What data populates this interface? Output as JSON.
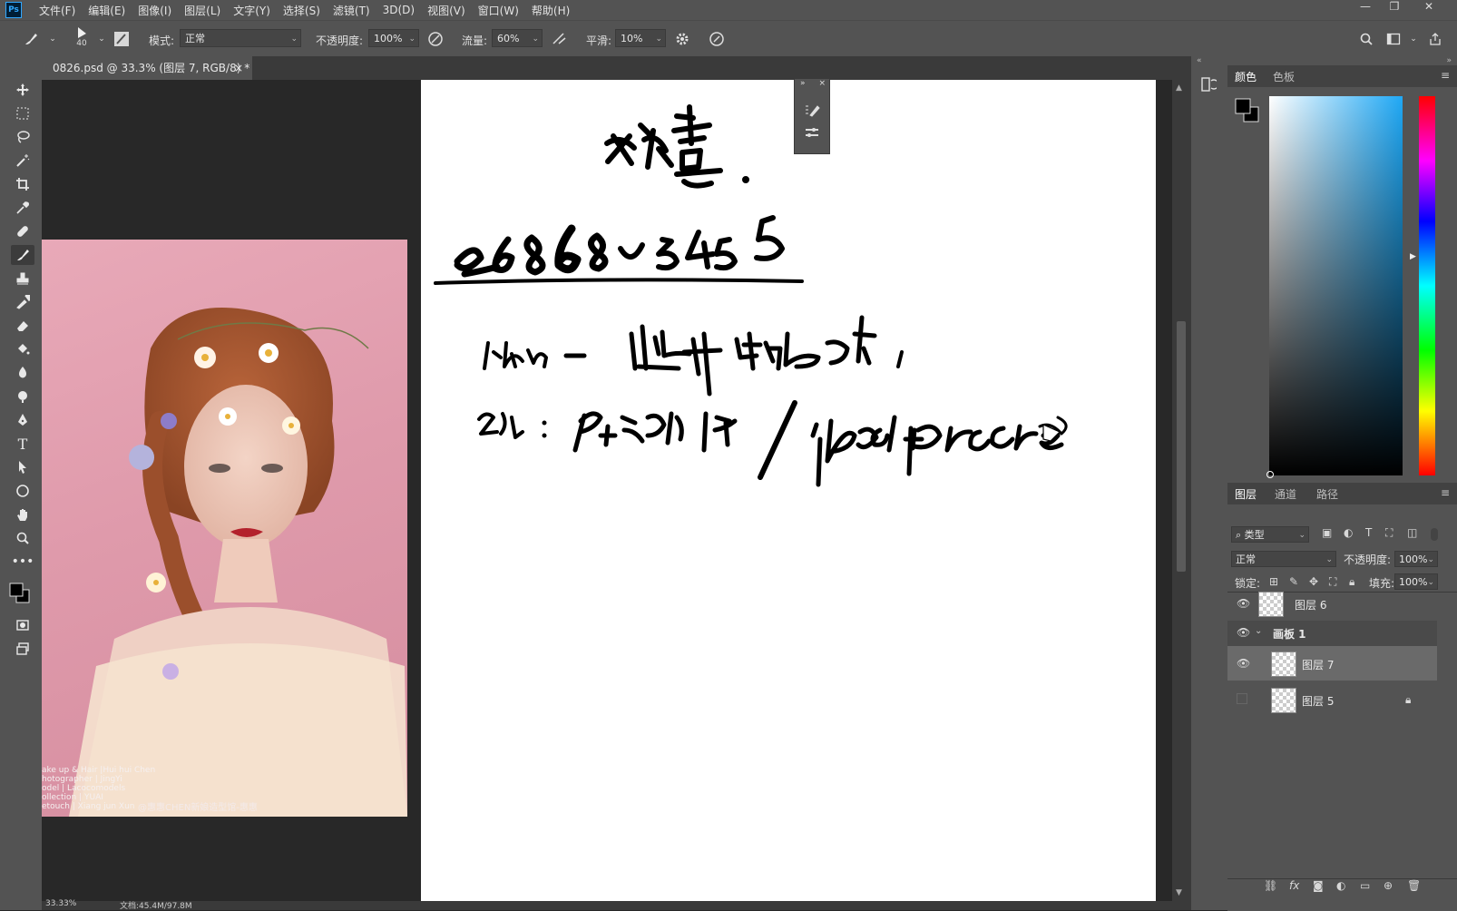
{
  "app": {
    "logo": "Ps"
  },
  "menu": [
    "文件(F)",
    "编辑(E)",
    "图像(I)",
    "图层(L)",
    "文字(Y)",
    "选择(S)",
    "滤镜(T)",
    "3D(D)",
    "视图(V)",
    "窗口(W)",
    "帮助(H)"
  ],
  "window_controls": {
    "minimize": "—",
    "restore": "❐",
    "close": "✕"
  },
  "options": {
    "brush_size": "40",
    "mode_label": "模式:",
    "mode_value": "正常",
    "opacity_label": "不透明度:",
    "opacity_value": "100%",
    "flow_label": "流量:",
    "flow_value": "60%",
    "smoothing_label": "平滑:",
    "smoothing_value": "10%"
  },
  "document": {
    "tab_title": "0826.psd @ 33.3% (图层 7, RGB/8) *",
    "close": "×"
  },
  "photo": {
    "credits": [
      "ake up & Hair |Hui hui Chen",
      "hotographer | JingYi",
      "odel | Lacocomodels",
      "ollection | YUAI",
      "etouch | Xiang jun Xun"
    ],
    "watermark": "@惠惠CHEN新娘造型馆-惠惠"
  },
  "status": {
    "zoom": "33.33%",
    "doc_info": "文档:45.4M/97.8M"
  },
  "color_panel": {
    "tab_color": "颜色",
    "tab_swatches": "色板"
  },
  "layers_panel": {
    "tab_layers": "图层",
    "tab_channels": "通道",
    "tab_paths": "路径",
    "filter_label": "类型",
    "blend_mode": "正常",
    "opacity_label": "不透明度:",
    "opacity_value": "100%",
    "lock_label": "锁定:",
    "fill_label": "填充:",
    "fill_value": "100%",
    "layers": [
      {
        "name": "图层 6"
      },
      {
        "name": "画板 1"
      },
      {
        "name": "图层 7"
      },
      {
        "name": "图层 5"
      }
    ]
  },
  "colors": {
    "accent": "#31a8ff",
    "panel_bg": "#535353",
    "canvas_bg": "#282828"
  }
}
